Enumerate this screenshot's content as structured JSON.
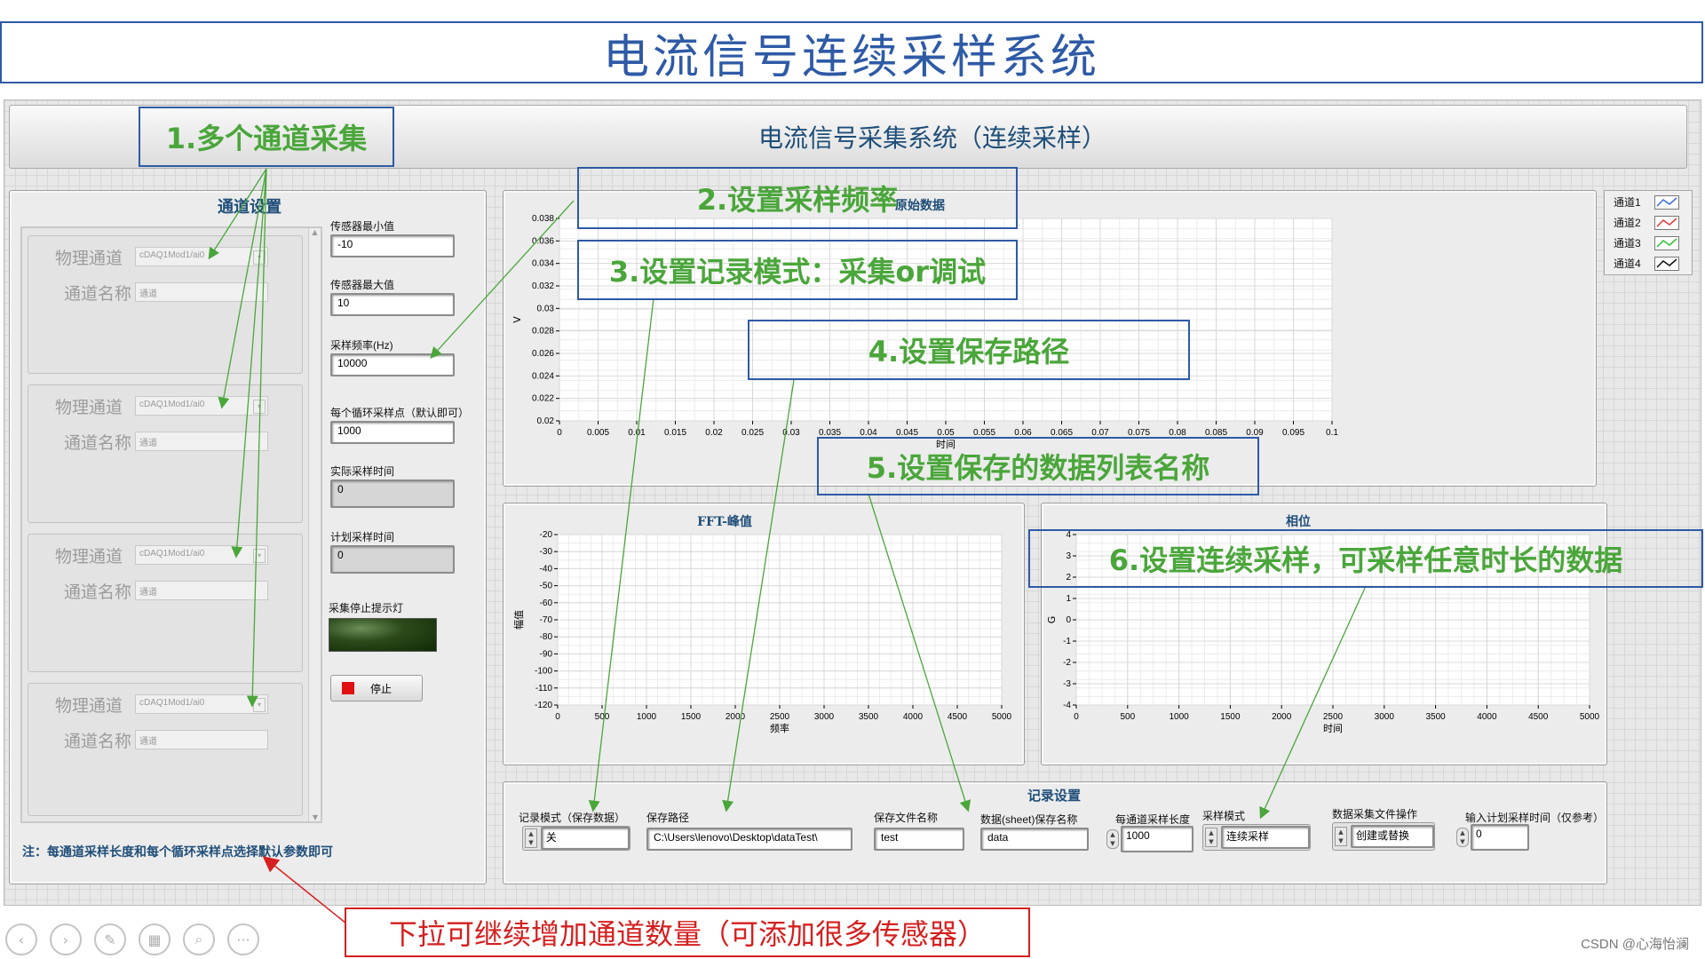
{
  "slide_title": "电流信号连续采样系统",
  "header": {
    "title": "电流信号采集系统（连续采样）"
  },
  "channel_settings": {
    "title": "通道设置",
    "label_physical": "物理通道",
    "label_name": "通道名称",
    "channels": [
      {
        "physical": "cDAQ1Mod1/ai0",
        "name": "通道"
      },
      {
        "physical": "cDAQ1Mod1/ai0",
        "name": "通道"
      },
      {
        "physical": "cDAQ1Mod1/ai0",
        "name": "通道"
      },
      {
        "physical": "cDAQ1Mod1/ai0",
        "name": "通道"
      }
    ],
    "note": "注：每通道采样长度和每个循环采样点选择默认参数即可"
  },
  "params": {
    "sensor_min_label": "传感器最小值",
    "sensor_min": "-10",
    "sensor_max_label": "传感器最大值",
    "sensor_max": "10",
    "rate_label": "采样频率(Hz)",
    "rate": "10000",
    "samples_label": "每个循环采样点（默认即可）",
    "samples": "1000",
    "actual_time_label": "实际采样时间",
    "actual_time": "0",
    "planned_time_label": "计划采样时间",
    "planned_time": "0",
    "stop_light_label": "采集停止提示灯",
    "stop_button": "停止"
  },
  "legend": [
    {
      "name": "通道1",
      "color": "#3a6fd8"
    },
    {
      "name": "通道2",
      "color": "#e83a3a"
    },
    {
      "name": "通道3",
      "color": "#2ec42e"
    },
    {
      "name": "通道4",
      "color": "#111111"
    }
  ],
  "chart_data": [
    {
      "type": "line",
      "title": "原始数据",
      "xlabel": "时间",
      "ylabel": "V",
      "xlim": [
        0,
        0.1
      ],
      "ylim": [
        0.02,
        0.038
      ],
      "x_ticks": [
        "0",
        "0.005",
        "0.01",
        "0.015",
        "0.02",
        "0.025",
        "0.03",
        "0.035",
        "0.04",
        "0.045",
        "0.05",
        "0.055",
        "0.06",
        "0.065",
        "0.07",
        "0.075",
        "0.08",
        "0.085",
        "0.09",
        "0.095",
        "0.1"
      ],
      "y_ticks": [
        "0.038",
        "0.036",
        "0.034",
        "0.032",
        "0.03",
        "0.028",
        "0.026",
        "0.024",
        "0.022",
        "0.02"
      ],
      "grid": true,
      "series": []
    },
    {
      "type": "line",
      "title": "FFT-峰值",
      "xlabel": "频率",
      "ylabel": "幅值",
      "xlim": [
        0,
        5000
      ],
      "ylim": [
        -120,
        -20
      ],
      "x_ticks": [
        "0",
        "500",
        "1000",
        "1500",
        "2000",
        "2500",
        "3000",
        "3500",
        "4000",
        "4500",
        "5000"
      ],
      "y_ticks": [
        "-20",
        "-30",
        "-40",
        "-50",
        "-60",
        "-70",
        "-80",
        "-90",
        "-100",
        "-110",
        "-120"
      ],
      "grid": true,
      "series": []
    },
    {
      "type": "line",
      "title": "相位",
      "xlabel": "时间",
      "ylabel": "G",
      "xlim": [
        0,
        5000
      ],
      "ylim": [
        -4,
        4
      ],
      "x_ticks": [
        "0",
        "500",
        "1000",
        "1500",
        "2000",
        "2500",
        "3000",
        "3500",
        "4000",
        "4500",
        "5000"
      ],
      "y_ticks": [
        "4",
        "3",
        "2",
        "1",
        "0",
        "-1",
        "-2",
        "-3",
        "-4"
      ],
      "grid": true,
      "series": []
    }
  ],
  "record_settings": {
    "title": "记录设置",
    "mode_label": "记录模式（保存数据）",
    "mode": "关",
    "path_label": "保存路径",
    "path": "C:\\Users\\lenovo\\Desktop\\dataTest\\",
    "file_label": "保存文件名称",
    "file": "test",
    "sheet_label": "数据(sheet)保存名称",
    "sheet": "data",
    "len_label": "每通道采样长度",
    "len": "1000",
    "sample_mode_label": "采样模式",
    "sample_mode": "连续采样",
    "file_op_label": "数据采集文件操作",
    "file_op": "创建或替换",
    "plan_time_label": "输入计划采样时间（仅参考）",
    "plan_time": "0"
  },
  "annotations": [
    "1.多个通道采集",
    "2.设置采样频率",
    "3.设置记录模式：采集or调试",
    "4.设置保存路径",
    "5.设置保存的数据列表名称",
    "6.设置连续采样，可采样任意时长的数据"
  ],
  "bottom_note": "下拉可继续增加通道数量（可添加很多传感器）",
  "watermark": "CSDN @心海怡澜",
  "toolbar_icons": [
    "prev-icon",
    "next-icon",
    "pen-icon",
    "layout-icon",
    "zoom-icon",
    "more-icon"
  ]
}
